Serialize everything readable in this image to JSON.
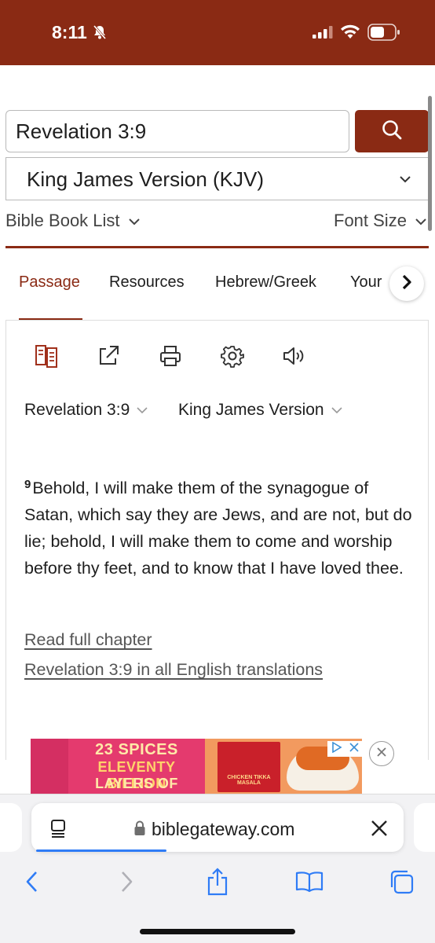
{
  "status_bar": {
    "time": "8:11",
    "bg_color": "#8a2a14",
    "icons": [
      "bell-slash-icon",
      "signal-icon",
      "wifi-icon",
      "battery-icon"
    ]
  },
  "search": {
    "value": "Revelation 3:9",
    "button_icon": "search-icon"
  },
  "version_select": {
    "value": "King James Version (KJV)"
  },
  "links_row": {
    "book_list": "Bible Book List",
    "font_size": "Font Size"
  },
  "tabs": [
    {
      "label": "Passage",
      "active": true
    },
    {
      "label": "Resources",
      "active": false
    },
    {
      "label": "Hebrew/Greek",
      "active": false
    },
    {
      "label": "Your",
      "active": false
    }
  ],
  "toolbar": {
    "icons": [
      "parallel-icon",
      "share-icon",
      "print-icon",
      "settings-icon",
      "audio-icon"
    ]
  },
  "passage_selectors": {
    "reference": "Revelation 3:9",
    "version": "King James Version"
  },
  "verse": {
    "number": "9",
    "text": "Behold, I will make them of the synagogue of Satan, which say they are Jews, and are not, but do lie; behold, I will make them to come and worship before thy feet, and to know that I have loved thee."
  },
  "links": {
    "full_chapter": "Read full chapter",
    "all_translations": "Revelation 3:9 in all English translations"
  },
  "ad": {
    "line1": "23 SPICES",
    "line2": "ELEVENTY BILLION",
    "line3": "LAYERS OF FLAVOR",
    "box_text": "CHICKEN TIKKA MASALA"
  },
  "browser": {
    "url": "biblegateway.com",
    "accent_color": "#2f7cf6"
  }
}
